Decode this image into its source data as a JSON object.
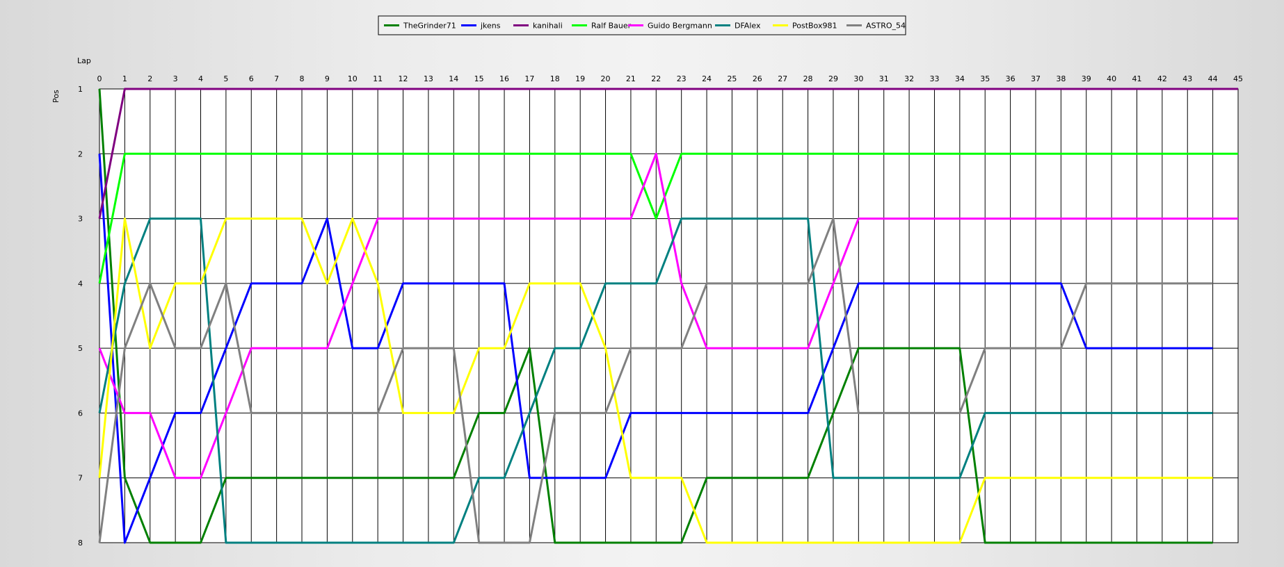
{
  "chart_data": {
    "type": "line",
    "xlabel": "Lap",
    "ylabel": "Pos",
    "xlim": [
      0,
      45
    ],
    "ylim": [
      1,
      8
    ],
    "y_inverted": true,
    "grid": true,
    "legend_position": "top-center",
    "x_ticks": [
      0,
      1,
      2,
      3,
      4,
      5,
      6,
      7,
      8,
      9,
      10,
      11,
      12,
      13,
      14,
      15,
      16,
      17,
      18,
      19,
      20,
      21,
      22,
      23,
      24,
      25,
      26,
      27,
      28,
      29,
      30,
      31,
      32,
      33,
      34,
      35,
      36,
      37,
      38,
      39,
      40,
      41,
      42,
      43,
      44,
      45
    ],
    "y_ticks": [
      1,
      2,
      3,
      4,
      5,
      6,
      7,
      8
    ],
    "series": [
      {
        "name": "TheGrinder71",
        "color": "#008000",
        "values": [
          1,
          7,
          8,
          8,
          8,
          7,
          7,
          7,
          7,
          7,
          7,
          7,
          7,
          7,
          7,
          6,
          6,
          5,
          8,
          8,
          8,
          8,
          8,
          8,
          7,
          7,
          7,
          7,
          7,
          6,
          5,
          5,
          5,
          5,
          5,
          8,
          8,
          8,
          8,
          8,
          8,
          8,
          8,
          8,
          8
        ]
      },
      {
        "name": "jkens",
        "color": "#0000ff",
        "values": [
          2,
          8,
          7,
          6,
          6,
          5,
          4,
          4,
          4,
          3,
          5,
          5,
          4,
          4,
          4,
          4,
          4,
          7,
          7,
          7,
          7,
          6,
          6,
          6,
          6,
          6,
          6,
          6,
          6,
          5,
          4,
          4,
          4,
          4,
          4,
          4,
          4,
          4,
          4,
          5,
          5,
          5,
          5,
          5,
          5
        ]
      },
      {
        "name": "kanihali",
        "color": "#800080",
        "values": [
          3,
          1,
          1,
          1,
          1,
          1,
          1,
          1,
          1,
          1,
          1,
          1,
          1,
          1,
          1,
          1,
          1,
          1,
          1,
          1,
          1,
          1,
          1,
          1,
          1,
          1,
          1,
          1,
          1,
          1,
          1,
          1,
          1,
          1,
          1,
          1,
          1,
          1,
          1,
          1,
          1,
          1,
          1,
          1,
          1,
          1
        ]
      },
      {
        "name": "Ralf Bauer",
        "color": "#00ff00",
        "values": [
          4,
          2,
          2,
          2,
          2,
          2,
          2,
          2,
          2,
          2,
          2,
          2,
          2,
          2,
          2,
          2,
          2,
          2,
          2,
          2,
          2,
          2,
          3,
          2,
          2,
          2,
          2,
          2,
          2,
          2,
          2,
          2,
          2,
          2,
          2,
          2,
          2,
          2,
          2,
          2,
          2,
          2,
          2,
          2,
          2,
          2
        ]
      },
      {
        "name": "Guido Bergmann",
        "color": "#ff00ff",
        "values": [
          5,
          6,
          6,
          7,
          7,
          6,
          5,
          5,
          5,
          5,
          4,
          3,
          3,
          3,
          3,
          3,
          3,
          3,
          3,
          3,
          3,
          3,
          2,
          4,
          5,
          5,
          5,
          5,
          5,
          4,
          3,
          3,
          3,
          3,
          3,
          3,
          3,
          3,
          3,
          3,
          3,
          3,
          3,
          3,
          3,
          3
        ]
      },
      {
        "name": "DFAlex",
        "color": "#008080",
        "values": [
          6,
          4,
          3,
          3,
          3,
          8,
          8,
          8,
          8,
          8,
          8,
          8,
          8,
          8,
          8,
          7,
          7,
          6,
          5,
          5,
          4,
          4,
          4,
          3,
          3,
          3,
          3,
          3,
          3,
          7,
          7,
          7,
          7,
          7,
          7,
          6,
          6,
          6,
          6,
          6,
          6,
          6,
          6,
          6,
          6
        ]
      },
      {
        "name": "PostBox981",
        "color": "#ffff00",
        "values": [
          7,
          3,
          5,
          4,
          4,
          3,
          3,
          3,
          3,
          4,
          3,
          4,
          6,
          6,
          6,
          5,
          5,
          4,
          4,
          4,
          5,
          7,
          7,
          7,
          8,
          8,
          8,
          8,
          8,
          8,
          8,
          8,
          8,
          8,
          8,
          7,
          7,
          7,
          7,
          7,
          7,
          7,
          7,
          7,
          7
        ]
      },
      {
        "name": "ASTRO_54",
        "color": "#808080",
        "values": [
          8,
          5,
          4,
          5,
          5,
          4,
          6,
          6,
          6,
          6,
          6,
          6,
          5,
          5,
          5,
          8,
          8,
          8,
          6,
          6,
          6,
          5,
          5,
          5,
          4,
          4,
          4,
          4,
          4,
          3,
          6,
          6,
          6,
          6,
          6,
          5,
          5,
          5,
          5,
          4,
          4,
          4,
          4,
          4,
          4
        ]
      }
    ]
  }
}
